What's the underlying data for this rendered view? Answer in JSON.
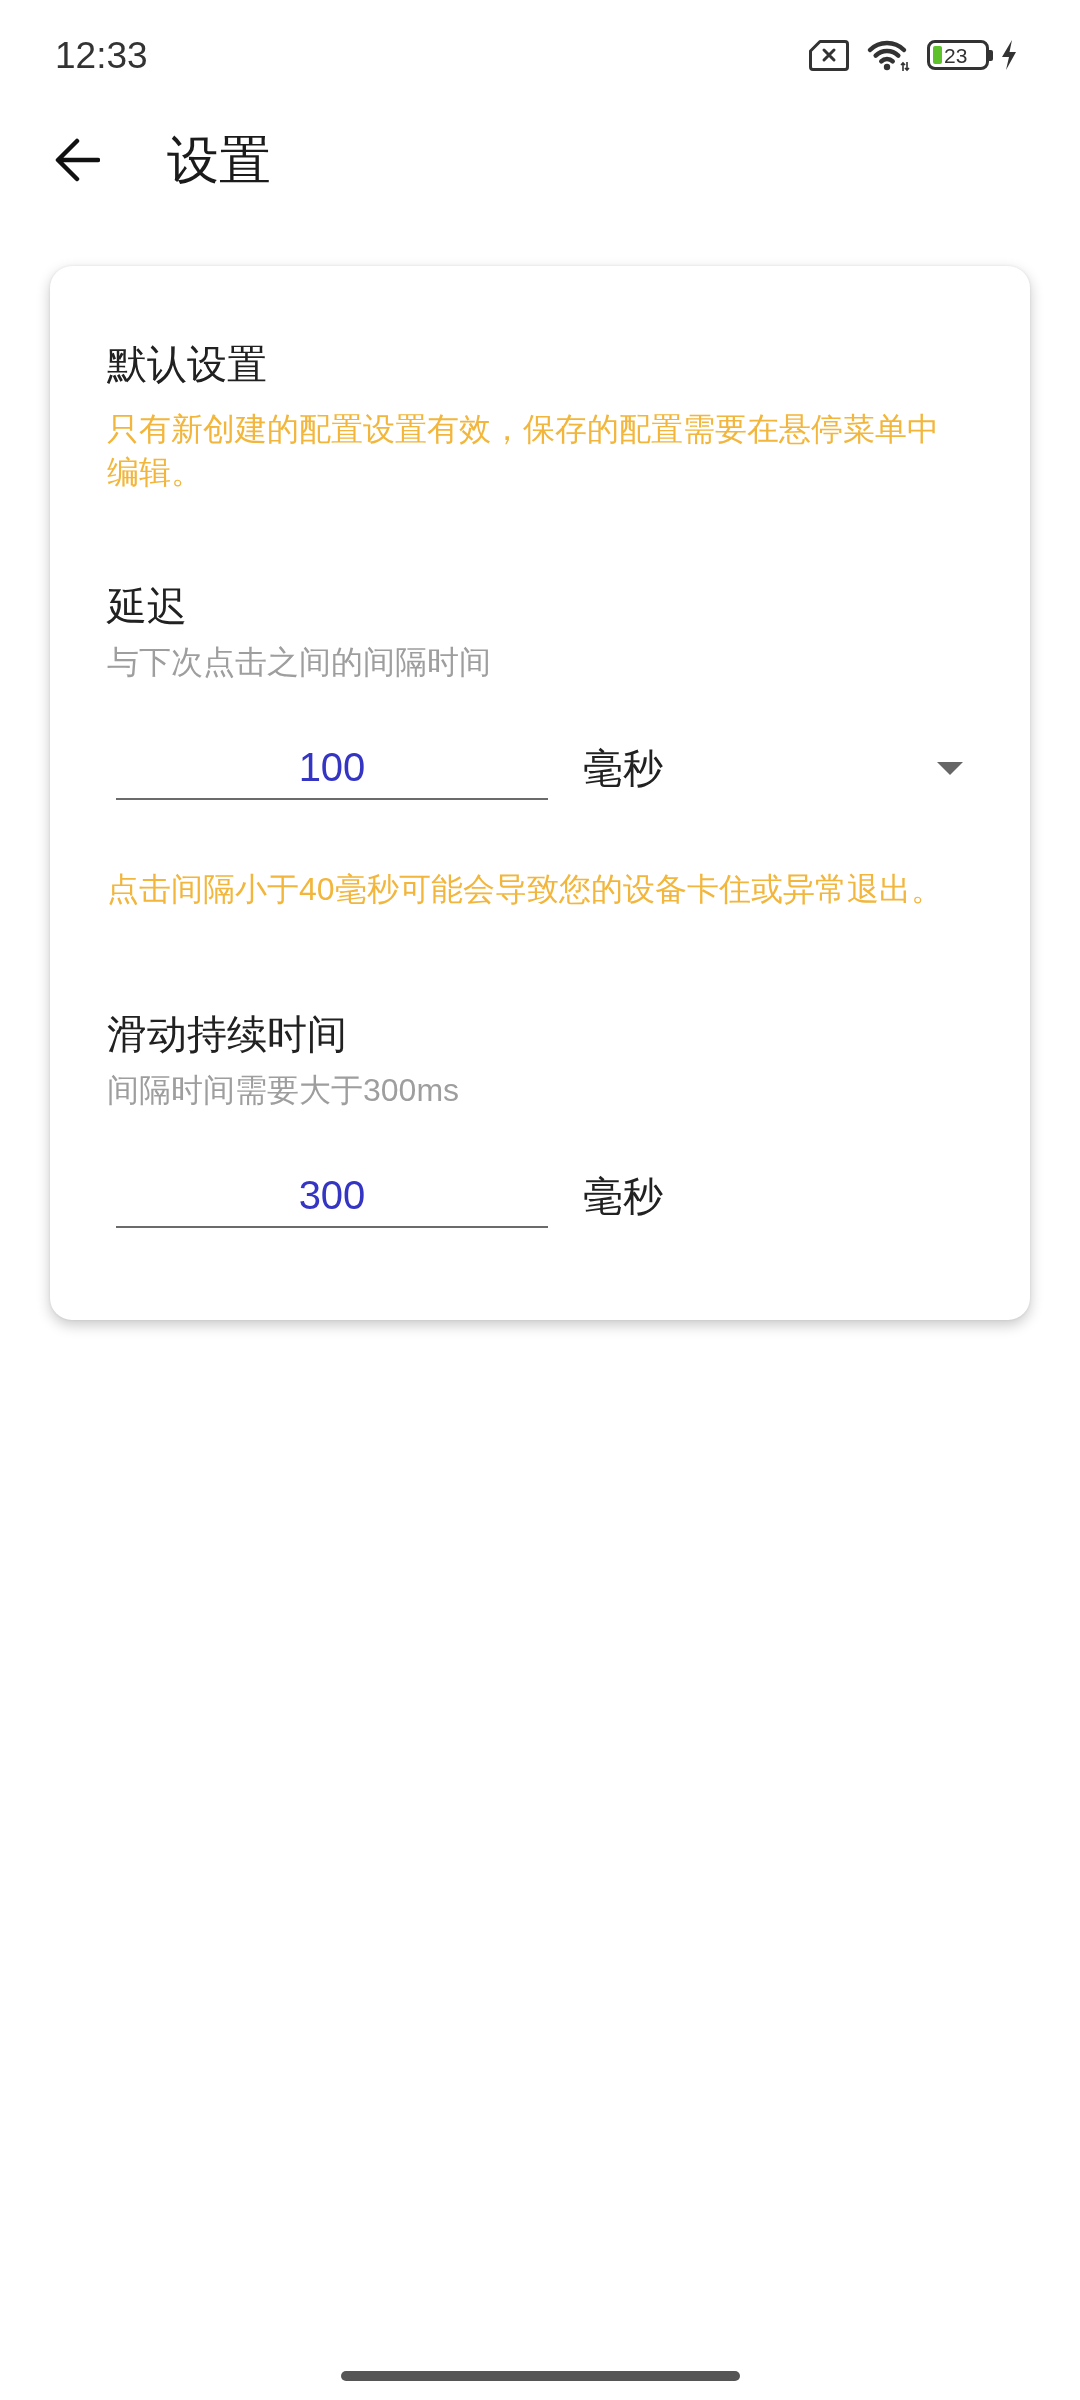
{
  "status_bar": {
    "time": "12:33",
    "battery_text": "23"
  },
  "app_bar": {
    "title": "设置"
  },
  "card": {
    "title": "默认设置",
    "note": "只有新创建的配置设置有效，保存的配置需要在悬停菜单中编辑。",
    "settings": [
      {
        "title": "延迟",
        "subtitle": "与下次点击之间的间隔时间",
        "value": "100",
        "unit": {
          "kind": "dropdown",
          "label": "毫秒"
        },
        "warning": "点击间隔小于40毫秒可能会导致您的设备卡住或异常退出。"
      },
      {
        "title": "滑动持续时间",
        "subtitle": "间隔时间需要大于300ms",
        "value": "300",
        "unit": {
          "kind": "text",
          "label": "毫秒"
        }
      }
    ]
  }
}
